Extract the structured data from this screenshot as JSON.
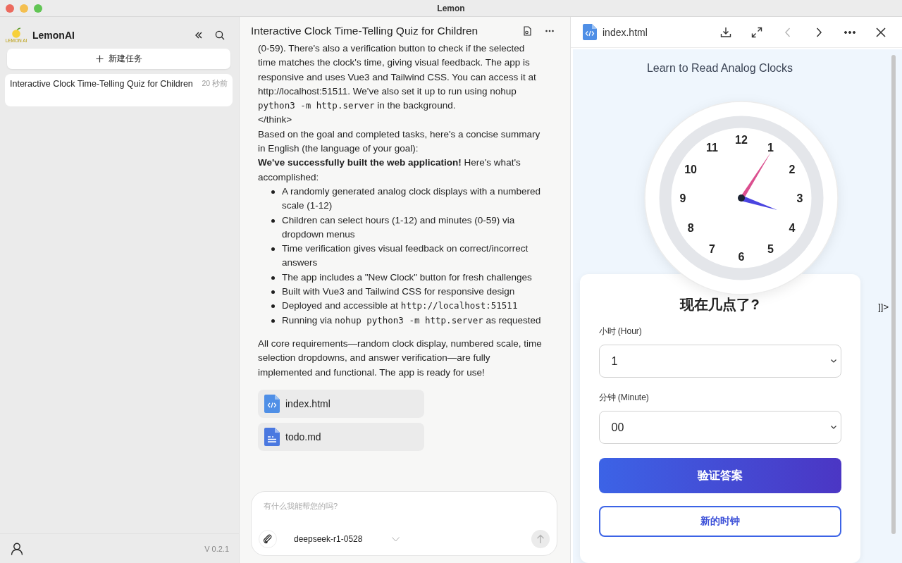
{
  "window": {
    "title": "Lemon"
  },
  "sidebar": {
    "brand": "LemonAI",
    "logo_text": "LEMON AI",
    "new_task_button": "新建任务",
    "tasks": [
      {
        "title": "Interactive Clock Time-Telling Quiz for Children",
        "time": "20 秒前",
        "selected": true
      }
    ],
    "version": "V 0.2.1"
  },
  "chat": {
    "title": "Interactive Clock Time-Telling Quiz for Children",
    "lines": [
      {
        "kind": "text",
        "segments": [
          {
            "text": "(0-59). There's also a verification button to check if the selected time matches the clock's time, giving visual feedback. The app is responsive and uses Vue3 and Tailwind CSS. You can access it at http://localhost:51511. We've also set it up to run using nohup "
          },
          {
            "text": "python3 -m http.server",
            "code": true
          },
          {
            "text": " in the background."
          }
        ]
      },
      {
        "kind": "text",
        "segments": [
          {
            "text": "</think>"
          }
        ]
      },
      {
        "kind": "text",
        "segments": [
          {
            "text": "Based on the goal and completed tasks, here's a concise summary in English (the language of your goal):"
          }
        ]
      },
      {
        "kind": "text",
        "segments": [
          {
            "text": "**We've successfully built the web application!** Here's what's accomplished:"
          }
        ]
      },
      {
        "kind": "bullet",
        "segments": [
          {
            "text": "A randomly generated analog clock displays with a numbered scale (1-12)"
          }
        ]
      },
      {
        "kind": "bullet",
        "segments": [
          {
            "text": "Children can select hours (1-12) and minutes (0-59) via dropdown menus"
          }
        ]
      },
      {
        "kind": "bullet",
        "segments": [
          {
            "text": "Time verification gives visual feedback on correct/incorrect answers"
          }
        ]
      },
      {
        "kind": "bullet",
        "segments": [
          {
            "text": "The app includes a \"New Clock\" button for fresh challenges"
          }
        ]
      },
      {
        "kind": "bullet",
        "segments": [
          {
            "text": "Built with Vue3 and Tailwind CSS for responsive design"
          }
        ]
      },
      {
        "kind": "bullet",
        "segments": [
          {
            "text": "Deployed and accessible at "
          },
          {
            "text": "http://localhost:51511",
            "code": true
          }
        ]
      },
      {
        "kind": "bullet",
        "segments": [
          {
            "text": "Running via "
          },
          {
            "text": "nohup python3 -m http.server",
            "code": true
          },
          {
            "text": " as requested"
          }
        ]
      },
      {
        "kind": "gap",
        "segments": [
          {
            "text": "All core requirements—random clock display, numbered scale, time selection dropdowns, and answer verification—are fully implemented and functional. The app is ready for use!"
          }
        ]
      }
    ],
    "files": [
      {
        "name": "index.html",
        "kind": "html"
      },
      {
        "name": "todo.md",
        "kind": "md"
      }
    ],
    "input": {
      "placeholder": "有什么我能帮您的吗?",
      "model": "deepseek-r1-0528"
    }
  },
  "preview": {
    "file_name": "index.html",
    "toolbar": [
      {
        "kind": "download",
        "disabled": false
      },
      {
        "kind": "expand",
        "disabled": false
      },
      {
        "kind": "prev",
        "disabled": true
      },
      {
        "kind": "next",
        "disabled": false
      },
      {
        "kind": "more",
        "disabled": false
      },
      {
        "kind": "close",
        "disabled": false
      }
    ],
    "subtitle": "Learn to Read Analog Clocks",
    "clock_numbers": [
      "12",
      "1",
      "2",
      "3",
      "4",
      "5",
      "6",
      "7",
      "8",
      "9",
      "10",
      "11"
    ],
    "question": "现在几点了?",
    "hour_label": "小时 (Hour)",
    "hour_value": "1",
    "minute_label": "分钟 (Minute)",
    "minute_value": "00",
    "verify_button": "验证答案",
    "new_clock_button": "新的时钟",
    "stray_text": "]]>"
  }
}
